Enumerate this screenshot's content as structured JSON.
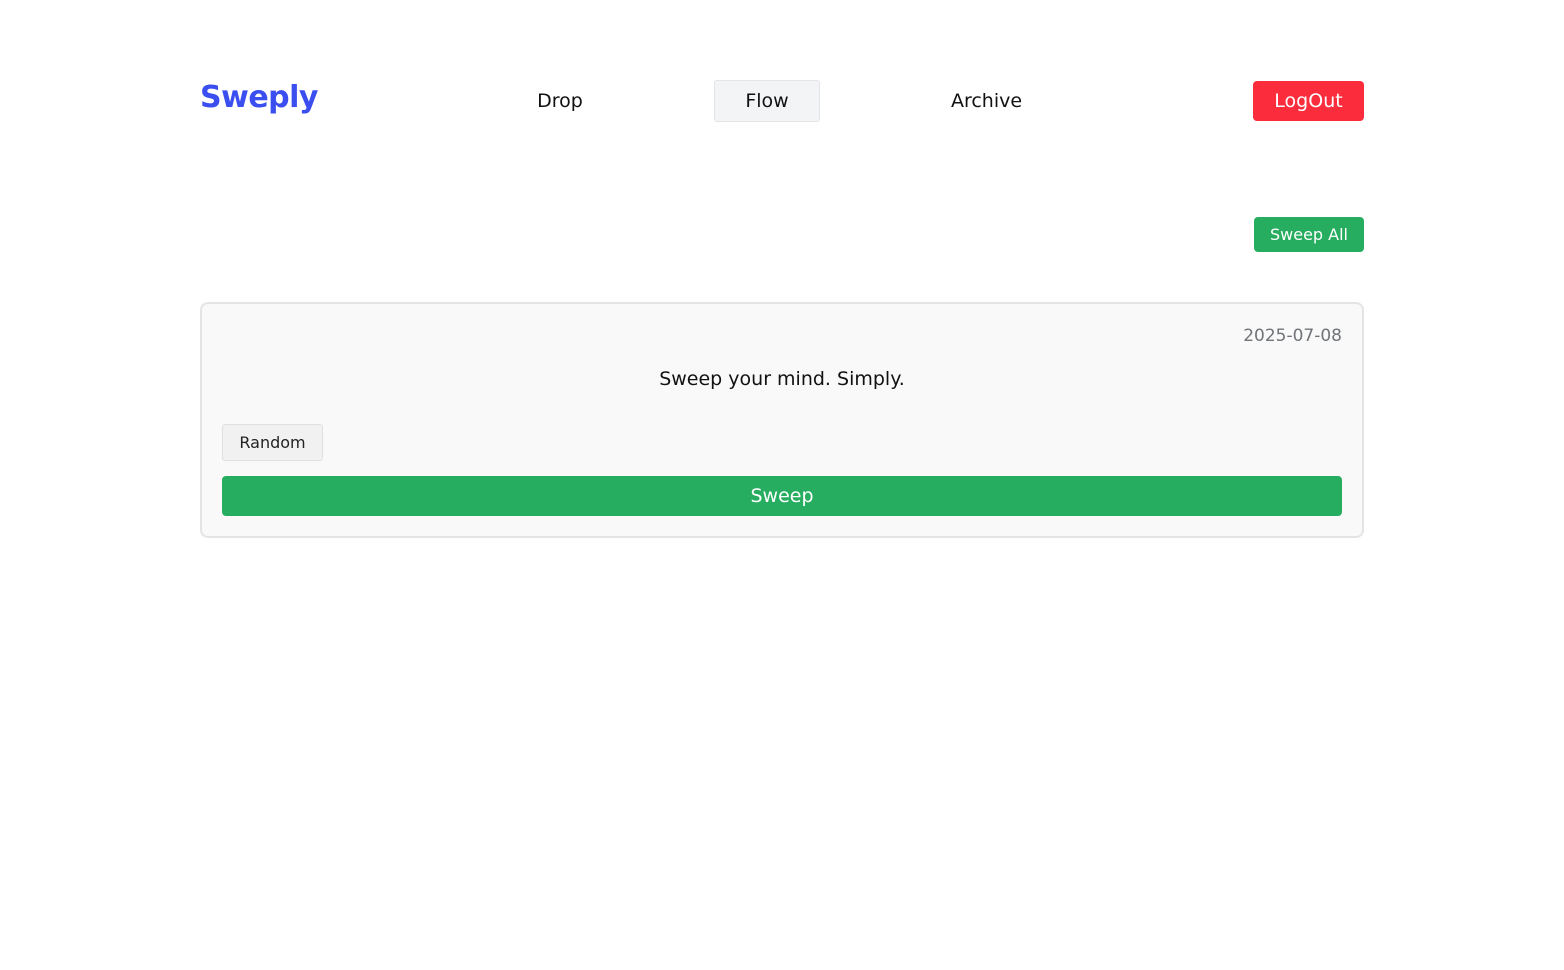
{
  "brand": {
    "name": "Sweply",
    "color": "#3b4ef0"
  },
  "nav": {
    "items": [
      {
        "label": "Drop",
        "active": false
      },
      {
        "label": "Flow",
        "active": true
      },
      {
        "label": "Archive",
        "active": false
      }
    ]
  },
  "header": {
    "logout_label": "LogOut",
    "logout_color": "#fb2d3d"
  },
  "toolbar": {
    "sweep_all_label": "Sweep All"
  },
  "cards": [
    {
      "date": "2025-07-08",
      "text": "Sweep your mind. Simply.",
      "tag": "Random",
      "action_label": "Sweep"
    }
  ],
  "colors": {
    "accent_green": "#26ad60",
    "card_background": "#f9f9f9",
    "muted_text": "#707478"
  }
}
